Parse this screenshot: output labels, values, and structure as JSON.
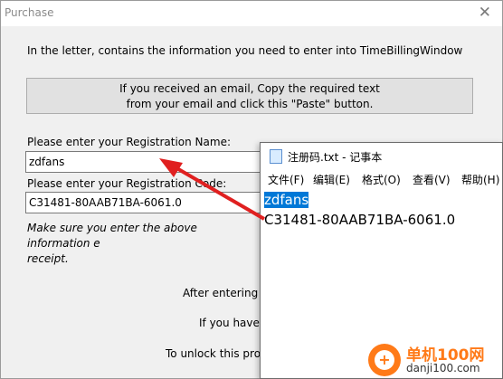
{
  "dialog": {
    "title": "Purchase",
    "close_glyph": "✕",
    "intro_text": "In the letter, contains the information you need to enter into TimeBillingWindow",
    "paste_button": {
      "line1": "If you received an email, Copy the required text",
      "line2": "from your email and click this \"Paste\" button."
    },
    "name_label": "Please enter your Registration Name:",
    "name_value": "zdfans",
    "code_label": "Please enter your Registration Code:",
    "code_value": "C31481-80AAB71BA-6061.0",
    "note_line1": "Make sure you enter the above information e",
    "note_line2": "receipt.",
    "after_text": "After entering t",
    "if_text": "If you have p",
    "unlock_text": "To unlock this pro"
  },
  "notepad": {
    "title": "注册码.txt - 记事本",
    "menu": [
      "文件(F)",
      "编辑(E)",
      "格式(O)",
      "查看(V)",
      "帮助(H)"
    ],
    "line1": "zdfans",
    "line2": "C31481-80AAB71BA-6061.0"
  },
  "watermark": {
    "name": "单机100网",
    "url": "danji100.com",
    "color": "#ff7a18"
  },
  "colors": {
    "arrow": "#e02020",
    "selection": "#0078d7"
  }
}
